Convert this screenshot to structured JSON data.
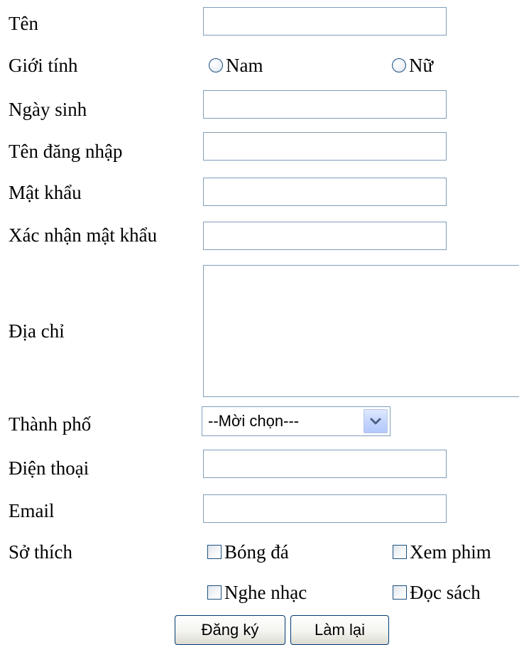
{
  "form": {
    "name_label": "Tên",
    "gender_label": "Giới tính",
    "gender_options": [
      "Nam",
      "Nữ"
    ],
    "birthdate_label": "Ngày sinh",
    "username_label": "Tên đăng nhập",
    "password_label": "Mật khẩu",
    "confirm_password_label": "Xác nhận mật khẩu",
    "address_label": "Địa chỉ",
    "city_label": "Thành phố",
    "city_selected": "--Mời chọn---",
    "phone_label": "Điện thoại",
    "email_label": "Email",
    "hobbies_label": "Sở thích",
    "hobbies": [
      "Bóng đá",
      "Xem phim",
      "Nghe nhạc",
      "Đọc sách"
    ]
  },
  "buttons": {
    "register": "Đăng ký",
    "reset": "Làm lại"
  },
  "icons": {
    "radio": "radio-unselected-icon",
    "checkbox": "checkbox-unchecked-icon",
    "dropdown": "chevron-down-icon"
  },
  "colors": {
    "input_border": "#7f9db9",
    "control_border": "#1c5180",
    "button_border": "#003c74",
    "dropdown_arrow": "#4d6185"
  }
}
